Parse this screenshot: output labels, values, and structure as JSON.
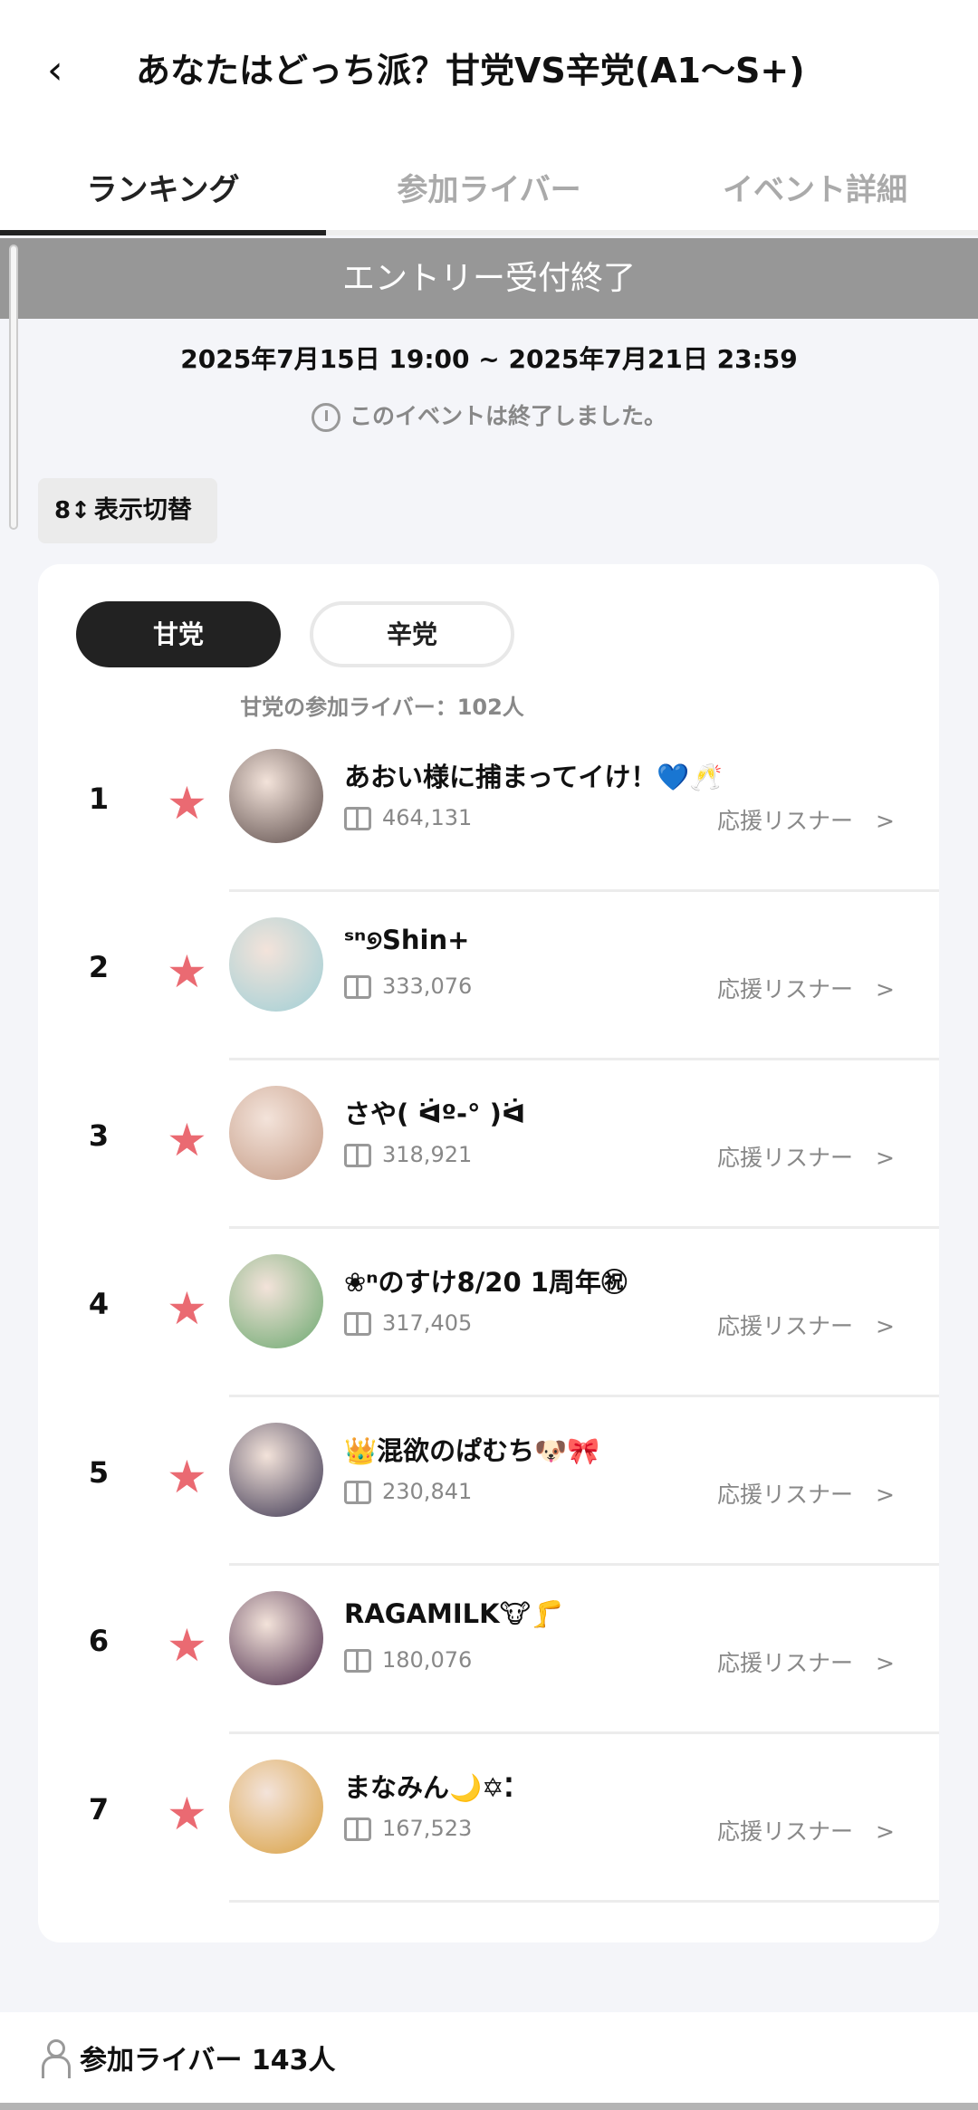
{
  "header": {
    "title": "あなたはどっち派？甘党VS辛党(A1〜S+)",
    "back_icon": "‹"
  },
  "tabs": [
    {
      "label": "ランキング",
      "active": true
    },
    {
      "label": "参加ライバー",
      "active": false
    },
    {
      "label": "イベント詳細",
      "active": false
    }
  ],
  "banner": "エントリー受付終了",
  "period": "2025年7月15日 19:00 ~ 2025年7月21日 23:59",
  "ended_note": "このイベントは終了しました。",
  "toggle": {
    "icon": "8↕",
    "label": "表示切替"
  },
  "groups": [
    {
      "label": "甘党",
      "selected": true
    },
    {
      "label": "辛党",
      "selected": false
    }
  ],
  "participant_count": "甘党の参加ライバー：102人",
  "support_label": "応援リスナー　>",
  "ranking": [
    {
      "rank": "1",
      "name": "あおい様に捕まってイけ！💙🥂",
      "points": "464,131",
      "color": "#5a4a48"
    },
    {
      "rank": "2",
      "name": "ˢⁿ୭Shin+",
      "points": "333,076",
      "color": "#9fcfd6"
    },
    {
      "rank": "3",
      "name": "さや( ᐛº-° )ᐛ",
      "points": "318,921",
      "color": "#c49a84"
    },
    {
      "rank": "4",
      "name": "❀ⁿのすけ8/20 1周年㊗",
      "points": "317,405",
      "color": "#6aa86e"
    },
    {
      "rank": "5",
      "name": "👑混欲のぱむち🐶🎀",
      "points": "230,841",
      "color": "#3a3450"
    },
    {
      "rank": "6",
      "name": "RAGAMILK🐮🦵",
      "points": "180,076",
      "color": "#4a2a4a"
    },
    {
      "rank": "7",
      "name": "まなみん🌙✡⁚",
      "points": "167,523",
      "color": "#d9a040"
    }
  ],
  "footer": {
    "label": "参加ライバー 143人"
  }
}
